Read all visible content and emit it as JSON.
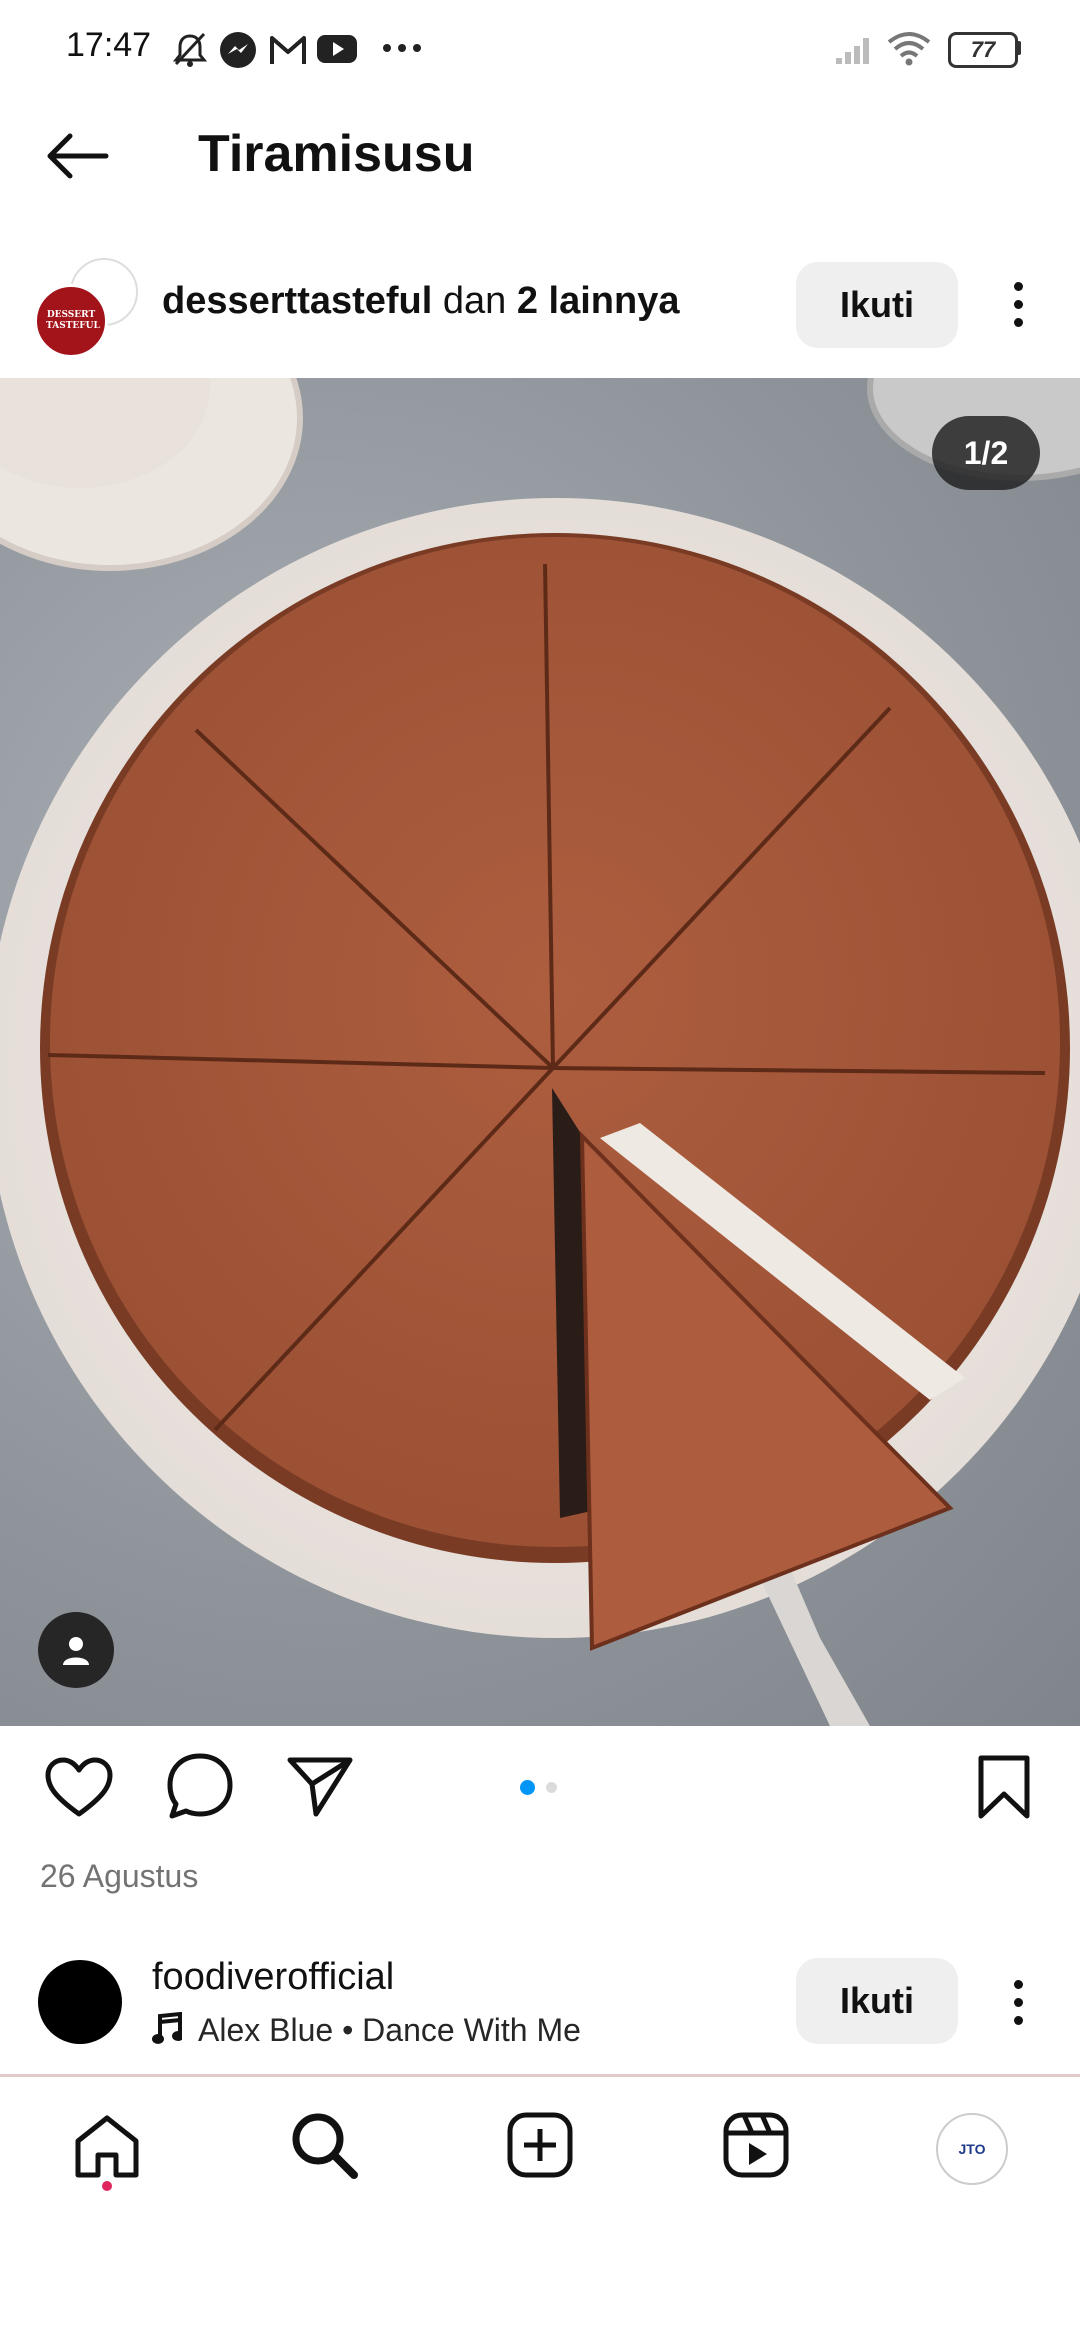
{
  "status_bar": {
    "time": "17:47",
    "icons": [
      "mute-icon",
      "messenger-icon",
      "gmail-icon",
      "youtube-icon",
      "more-icon"
    ],
    "battery": "77"
  },
  "header": {
    "title": "Tiramisusu",
    "back_icon": "arrow-left-icon"
  },
  "post": {
    "author": "desserttasteful",
    "connector": " dan ",
    "others": "2 lainnya",
    "follow_label": "Ikuti",
    "avatar_text": "DESSERT TASTEFUL",
    "image_counter": "1/2",
    "carousel": {
      "total": 2,
      "active": 1
    },
    "date": "26 Agustus",
    "accent_color": "#0095f6"
  },
  "next_post": {
    "author": "foodiverofficial",
    "music": "Alex Blue • Dance With Me",
    "follow_label": "Ikuti"
  },
  "bottom_nav": {
    "items": [
      "home-icon",
      "search-icon",
      "create-icon",
      "reels-icon",
      "profile-icon"
    ],
    "profile_text": "JTO"
  }
}
